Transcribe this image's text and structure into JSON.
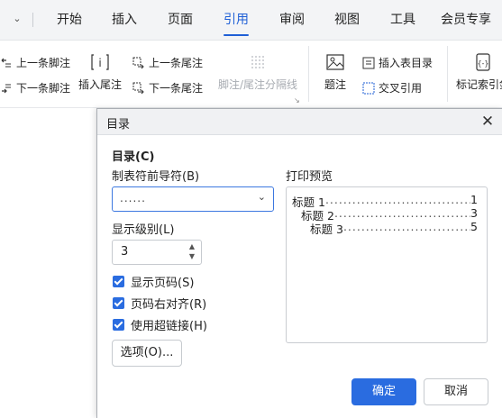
{
  "tabs": [
    {
      "label": "开始"
    },
    {
      "label": "插入"
    },
    {
      "label": "页面"
    },
    {
      "label": "引用"
    },
    {
      "label": "审阅"
    },
    {
      "label": "视图"
    },
    {
      "label": "工具"
    },
    {
      "label": "会员专享"
    }
  ],
  "active_tab": "引用",
  "ribbon": {
    "prev_footnote": "上一条脚注",
    "next_footnote": "下一条脚注",
    "insert_endnote": "插入尾注",
    "prev_endnote": "上一条尾注",
    "next_endnote": "下一条尾注",
    "footnote_separator": "脚注/尾注分隔线",
    "caption": "题注",
    "insert_table_of_figures": "插入表目录",
    "cross_reference": "交叉引用",
    "mark_index_entry": "标记索引剑"
  },
  "dialog": {
    "title": "目录",
    "close_icon": "close-icon",
    "section_title": "目录(C)",
    "tab_leader_label": "制表符前导符(B)",
    "tab_leader_value": "......",
    "show_levels_label": "显示级别(L)",
    "show_levels_value": "3",
    "show_page_numbers": "显示页码(S)",
    "right_align_page_numbers": "页码右对齐(R)",
    "use_hyperlinks": "使用超链接(H)",
    "options_button": "选项(O)...",
    "preview_label": "打印预览",
    "preview_lines": [
      {
        "text": "标题 1",
        "page": "1"
      },
      {
        "text": "标题 2",
        "page": "3"
      },
      {
        "text": "标题 3",
        "page": "5"
      }
    ],
    "ok_button": "确定",
    "cancel_button": "取消"
  },
  "colors": {
    "accent": "#2a6ce0",
    "active_tab": "#1f5fd6"
  }
}
